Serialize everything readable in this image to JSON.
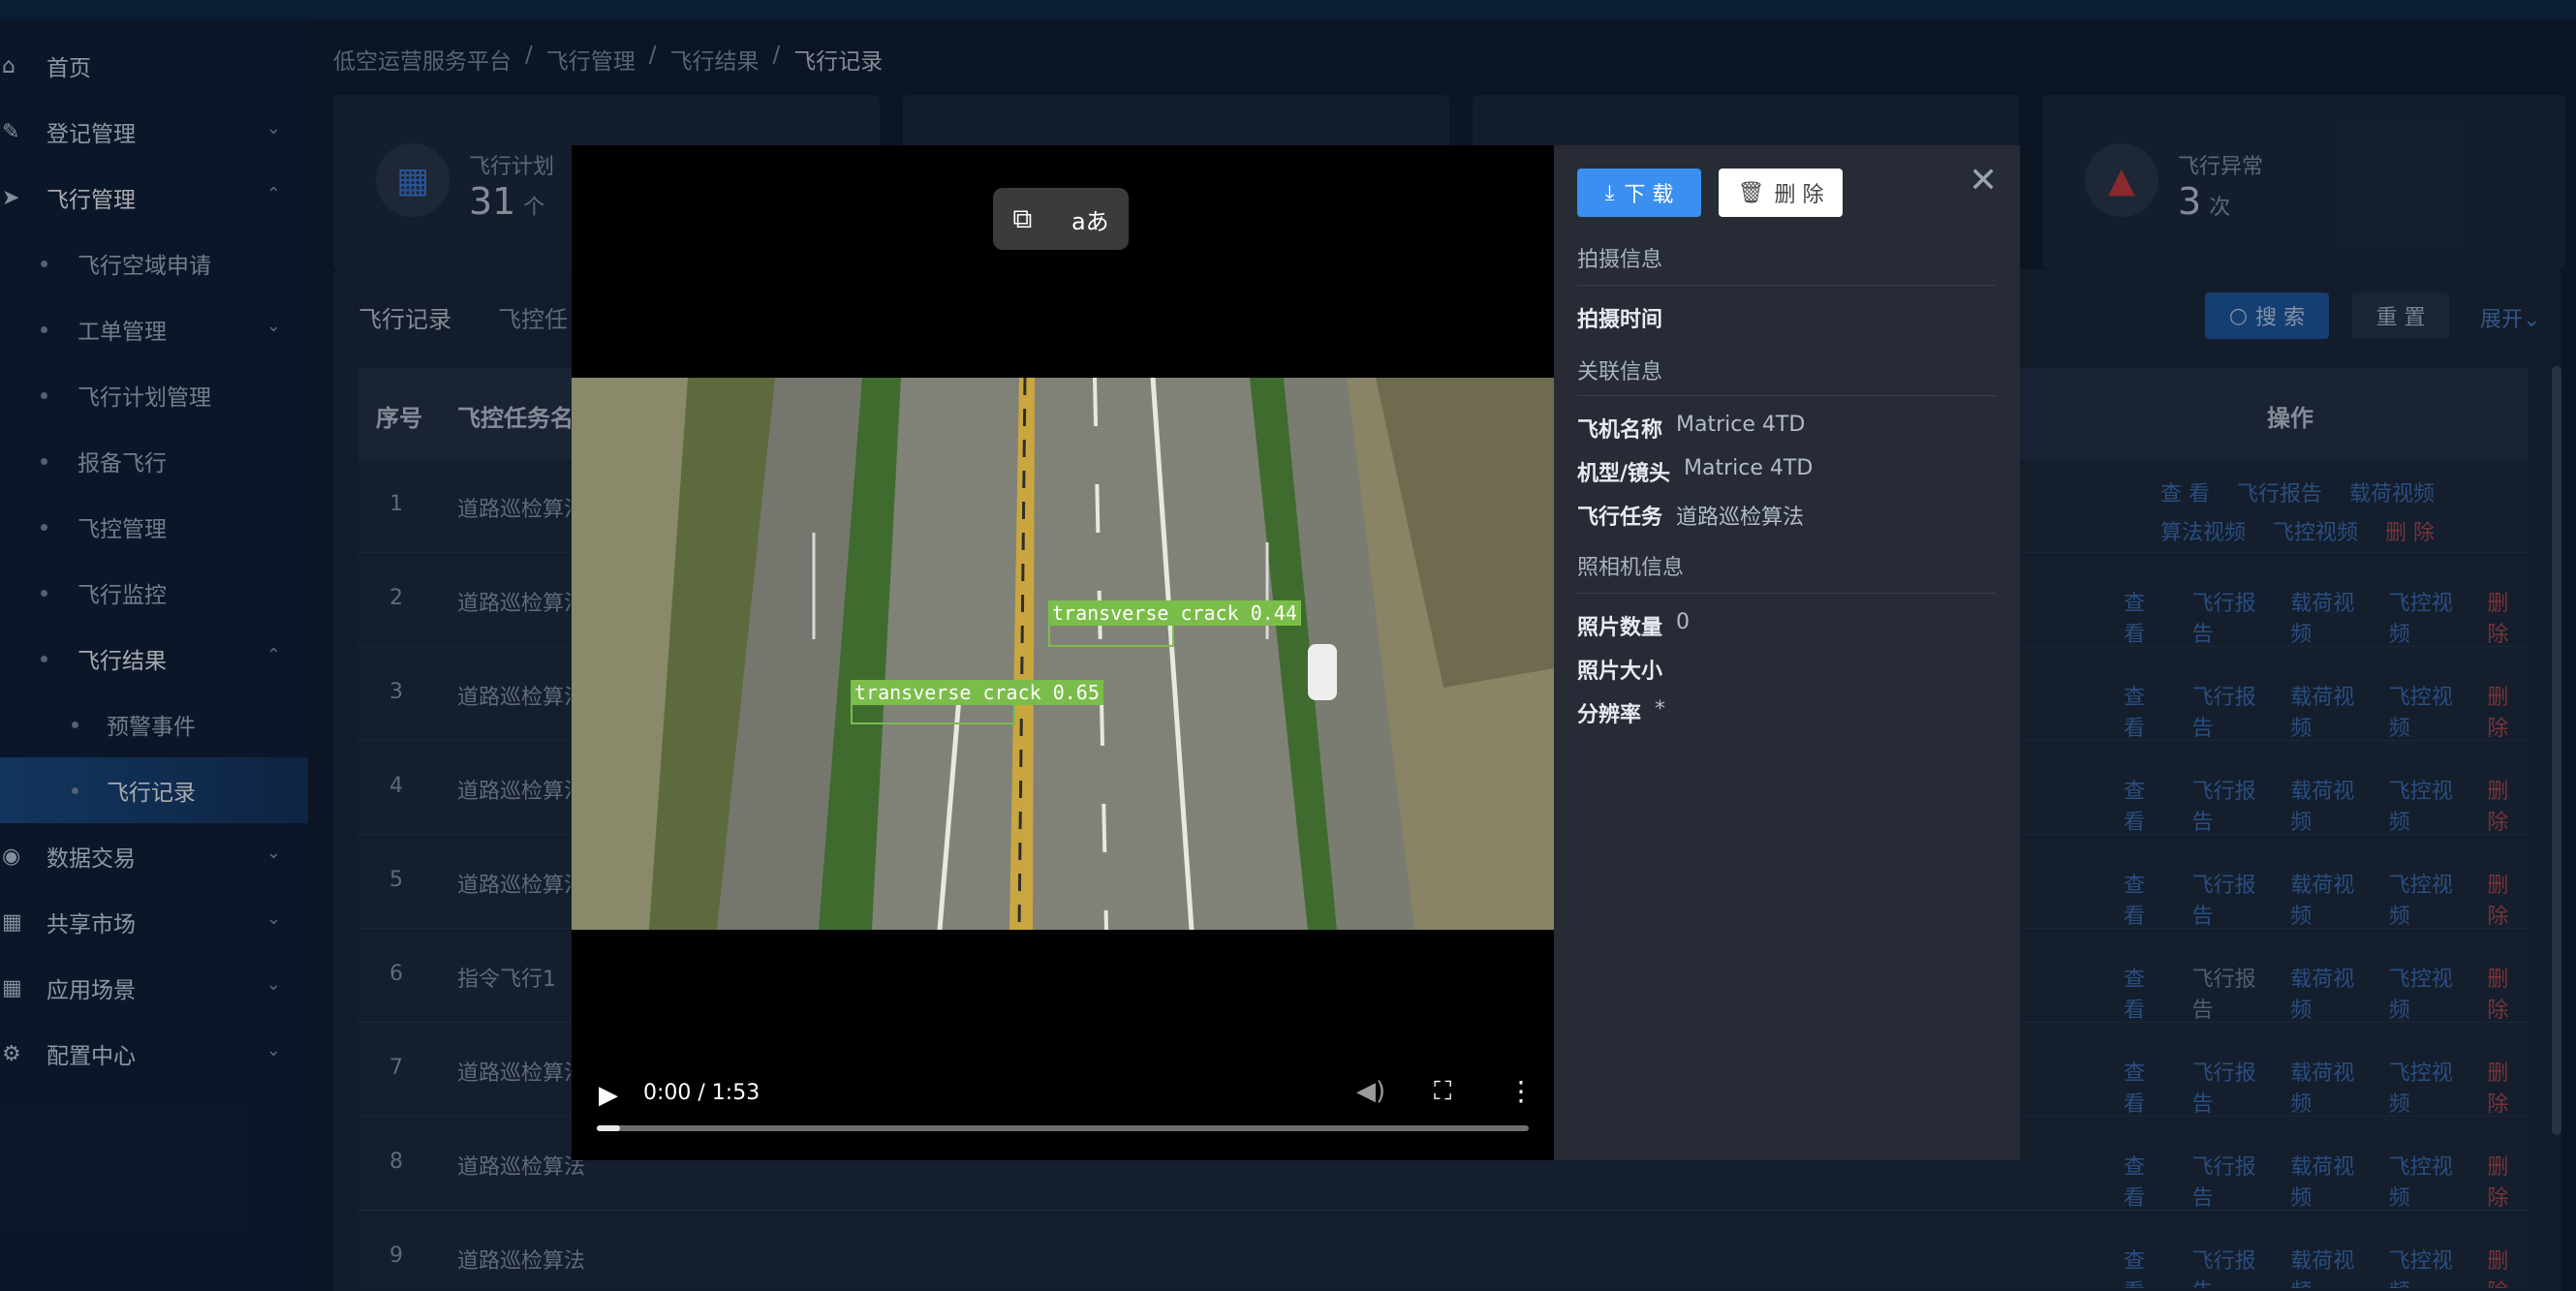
{
  "sidebar": {
    "items": [
      {
        "label": "首页",
        "icon": "home-icon"
      },
      {
        "label": "登记管理",
        "icon": "registration-icon"
      },
      {
        "label": "飞行管理",
        "icon": "plane-icon"
      },
      {
        "label": "飞行空域申请"
      },
      {
        "label": "工单管理"
      },
      {
        "label": "飞行计划管理"
      },
      {
        "label": "报备飞行"
      },
      {
        "label": "飞控管理"
      },
      {
        "label": "飞行监控"
      },
      {
        "label": "飞行结果"
      },
      {
        "label": "预警事件"
      },
      {
        "label": "飞行记录"
      },
      {
        "label": "数据交易",
        "icon": "data-trade-icon"
      },
      {
        "label": "共享市场",
        "icon": "market-icon"
      },
      {
        "label": "应用场景",
        "icon": "scene-icon"
      },
      {
        "label": "配置中心",
        "icon": "settings-icon"
      }
    ]
  },
  "breadcrumb": [
    "低空运营服务平台",
    "飞行管理",
    "飞行结果",
    "飞行记录"
  ],
  "breadcrumb_sep": "/",
  "stats": [
    {
      "label": "飞行计划",
      "value": "31",
      "unit": "个"
    },
    {
      "label": "飞行异常",
      "value": "3",
      "unit": "次"
    }
  ],
  "tabs": [
    "飞行记录",
    "飞控任"
  ],
  "toolbar": {
    "search": "搜 索",
    "reset": "重 置",
    "expand": "展开"
  },
  "table": {
    "headers": {
      "index": "序号",
      "task": "飞控任务名称",
      "ops": "操作"
    },
    "rows": [
      {
        "index": "1",
        "task": "道路巡检算法"
      },
      {
        "index": "2",
        "task": "道路巡检算法"
      },
      {
        "index": "3",
        "task": "道路巡检算法"
      },
      {
        "index": "4",
        "task": "道路巡检算法"
      },
      {
        "index": "5",
        "task": "道路巡检算法"
      },
      {
        "index": "6",
        "task": "指令飞行1"
      },
      {
        "index": "7",
        "task": "道路巡检算法"
      },
      {
        "index": "8",
        "task": "道路巡检算法"
      },
      {
        "index": "9",
        "task": "道路巡检算法"
      }
    ],
    "ops": {
      "view": "查 看",
      "report": "飞行报告",
      "payload": "载荷视频",
      "algo": "算法视频",
      "ctrl": "飞控视频",
      "delete": "删 除"
    }
  },
  "modal": {
    "download": "下 载",
    "delete": "删 除",
    "sections": {
      "shoot": "拍摄信息",
      "related": "关联信息",
      "camera": "照相机信息"
    },
    "fields": {
      "shoot_time_k": "拍摄时间",
      "aircraft_k": "飞机名称",
      "aircraft_v": "Matrice 4TD",
      "model_k": "机型/镜头",
      "model_v": "Matrice 4TD",
      "task_k": "飞行任务",
      "task_v": "道路巡检算法",
      "photo_count_k": "照片数量",
      "photo_count_v": "0",
      "photo_size_k": "照片大小",
      "resolution_k": "分辨率",
      "resolution_v": "*"
    },
    "video": {
      "time": "0:00 / 1:53",
      "progress": 0.0,
      "detections": [
        {
          "label": "transverse crack 0.44"
        },
        {
          "label": "transverse crack 0.65"
        }
      ]
    }
  }
}
